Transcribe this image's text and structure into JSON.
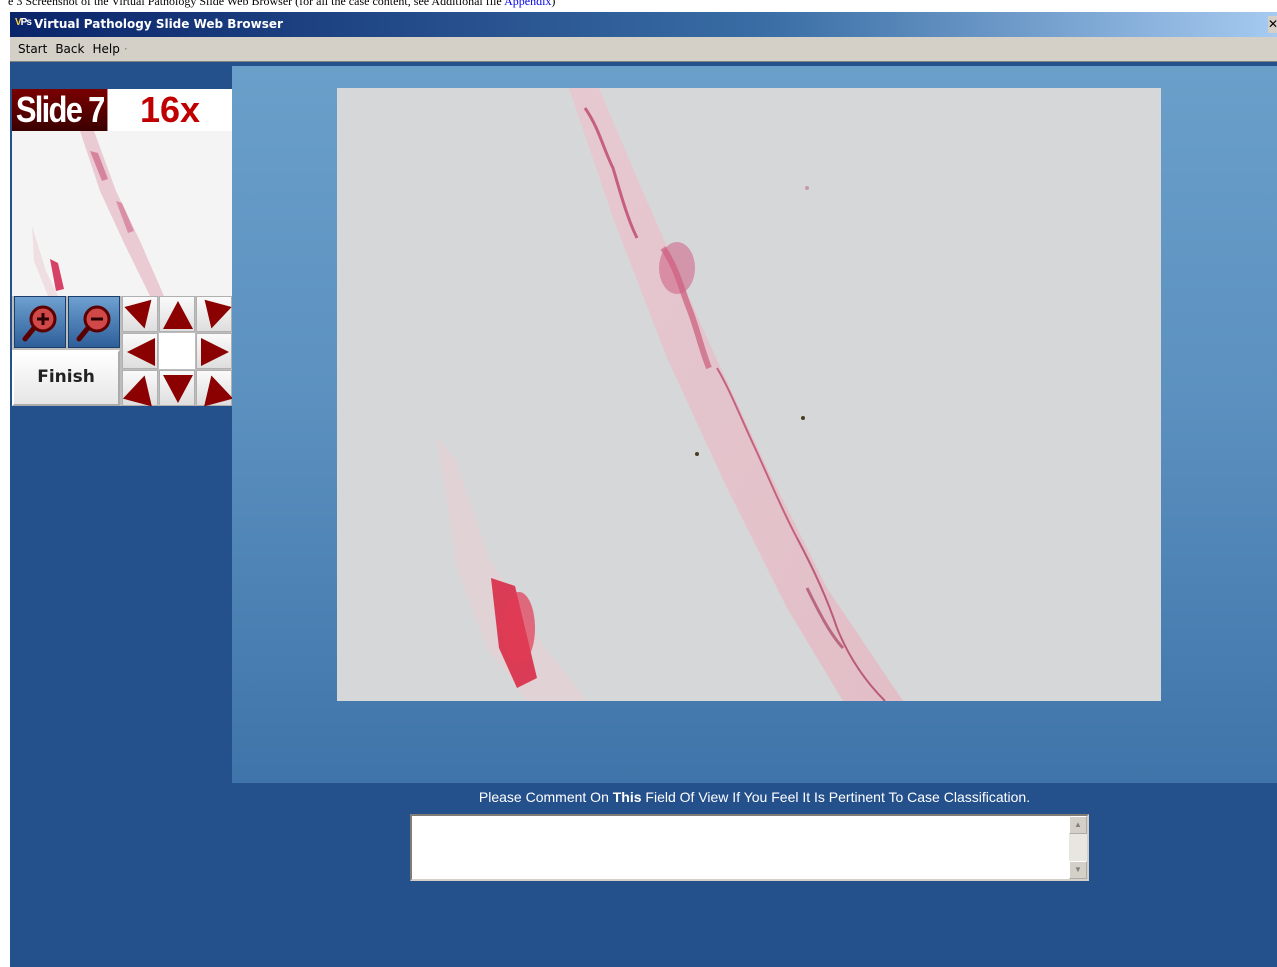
{
  "caption": {
    "text": "e 3 Screenshot of the Virtual Pathology Slide Web Browser (for all the case content, see Additional file ",
    "link": "Appendix",
    "suffix": ")"
  },
  "window": {
    "icon_text": "VPS",
    "title": "Virtual Pathology Slide Web Browser",
    "close_glyph": "✕"
  },
  "menu": {
    "items": [
      "Start",
      "Back",
      "Help"
    ],
    "separator": "·"
  },
  "slide": {
    "label": "Slide 7",
    "zoom": "16x"
  },
  "controls": {
    "zoom_in": "zoom-in-icon",
    "zoom_out": "zoom-out-icon",
    "finish_label": "Finish"
  },
  "comment": {
    "prompt_before": "Please Comment On ",
    "prompt_bold": "This",
    "prompt_after": " Field Of View If You Feel It Is Pertinent To Case Classification.",
    "value": "",
    "scroll_up": "▲",
    "scroll_down": "▼"
  },
  "colors": {
    "app_background": "#24508c",
    "viewer_gradient_top": "#6a9fca",
    "title_bar_start": "#0a246a",
    "slide_label_bg": "#7a0000",
    "zoom_label": "#c00000",
    "arrow_color": "#8b0000",
    "tissue_stain": "#d6527a"
  }
}
